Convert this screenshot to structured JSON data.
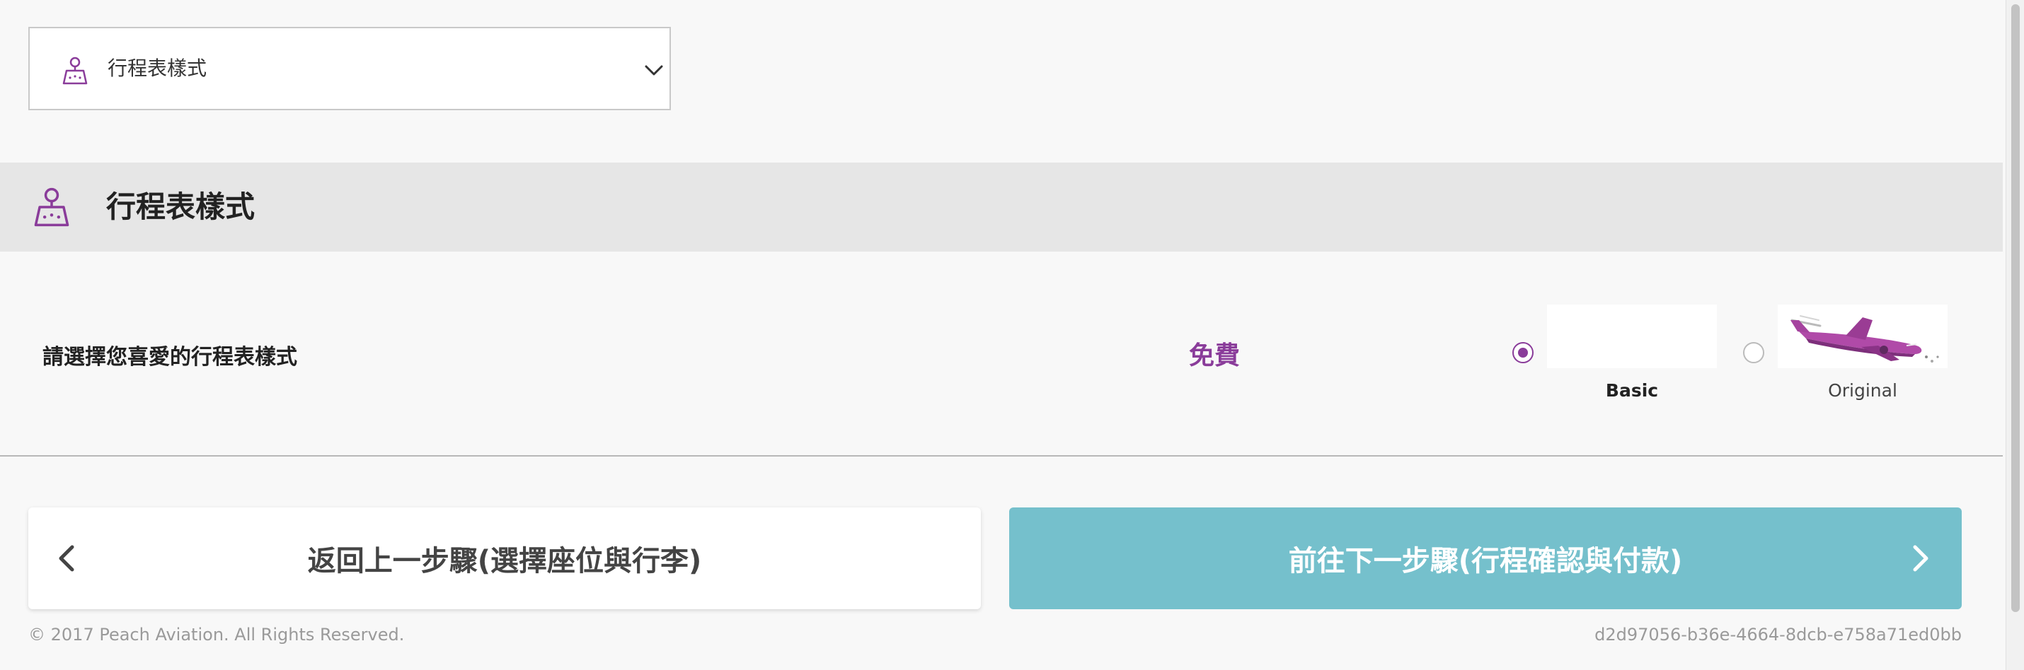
{
  "dropdown": {
    "label": "行程表樣式",
    "icon": "map-pin-icon"
  },
  "section": {
    "title": "行程表樣式",
    "icon": "map-pin-icon"
  },
  "option_row": {
    "prompt": "請選擇您喜愛的行程表樣式",
    "price": "免費",
    "options": [
      {
        "label": "Basic",
        "selected": true
      },
      {
        "label": "Original",
        "selected": false
      }
    ]
  },
  "nav": {
    "back_label": "返回上一步驟(選擇座位與行李)",
    "next_label": "前往下一步驟(行程確認與付款)"
  },
  "footer": {
    "copyright": "© 2017 Peach Aviation. All Rights Reserved.",
    "session_id": "d2d97056-b36e-4664-8dcb-e758a71ed0bb"
  },
  "colors": {
    "brand_purple": "#8a3c9a",
    "next_button": "#75c0cc",
    "section_bar": "#e6e6e6"
  }
}
